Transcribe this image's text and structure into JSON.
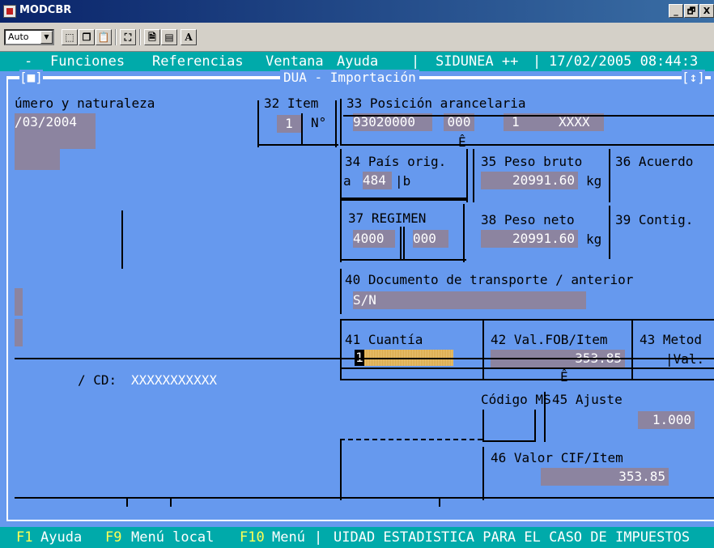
{
  "window": {
    "title": "MODCBR",
    "controls": [
      "_",
      "🗗",
      "X"
    ]
  },
  "toolbar": {
    "font_size_value": "Auto",
    "font_button": "A"
  },
  "menu": {
    "dash": "-",
    "funciones": "Funciones",
    "referencias": "Referencias",
    "ventana": "Ventana",
    "ayuda": "Ayuda",
    "system": "SIDUNEA ++",
    "datetime": "17/02/2005 08:44:3"
  },
  "frame": {
    "left_marker": "[■]",
    "title": "DUA - Importación",
    "right_marker": "[↕]"
  },
  "box31": {
    "label": "úmero y naturaleza",
    "date": "/03/2004"
  },
  "box32": {
    "label": "32 Item",
    "value": "1",
    "suffix": "N°"
  },
  "box33": {
    "label": "33 Posición arancelaria",
    "code": "93020000",
    "sub1": "000",
    "sub2": "",
    "sub3": "1",
    "sub4": "XXXX"
  },
  "box34": {
    "label": "34 País orig.",
    "prefix_a": "a",
    "value_a": "484",
    "prefix_b": "|b",
    "value_b": ""
  },
  "box35": {
    "label": "35 Peso bruto",
    "value": "20991.60",
    "unit": "kg"
  },
  "box36": {
    "label": "36 Acuerdo",
    "value": ""
  },
  "box37": {
    "label": "37 REGIMEN",
    "value1": "4000",
    "value2": "000"
  },
  "box38": {
    "label": "38 Peso neto",
    "value": "20991.60",
    "unit": "kg"
  },
  "box39": {
    "label": "39 Contig.",
    "value": ""
  },
  "box40": {
    "label": "40 Documento de transporte / anterior",
    "value": "S/N"
  },
  "box41": {
    "label": "41 Cuantía",
    "value": "1"
  },
  "box42": {
    "label": "42 Val.FOB/Item",
    "value": "353.85"
  },
  "box43": {
    "label": "43 Metod",
    "sub": "|Val."
  },
  "cd": {
    "label": "/ CD:",
    "value": "XXXXXXXXXXX"
  },
  "box44": {
    "label": "Código MS"
  },
  "box45": {
    "label": "45 Ajuste",
    "value": "1.000"
  },
  "box46": {
    "label": "46 Valor CIF/Item",
    "value": "353.85"
  },
  "status": {
    "f1": "F1",
    "f1_label": "Ayuda",
    "f9": "F9",
    "f9_label": "Menú local",
    "f10": "F10",
    "f10_label": "Menú",
    "message": "UIDAD ESTADISTICA PARA EL CASO DE IMPUESTOS"
  },
  "colors": {
    "background": "#6699ee",
    "menubar": "#00aaaa",
    "field": "#8c84a0",
    "titlebar": "#0a246a"
  }
}
